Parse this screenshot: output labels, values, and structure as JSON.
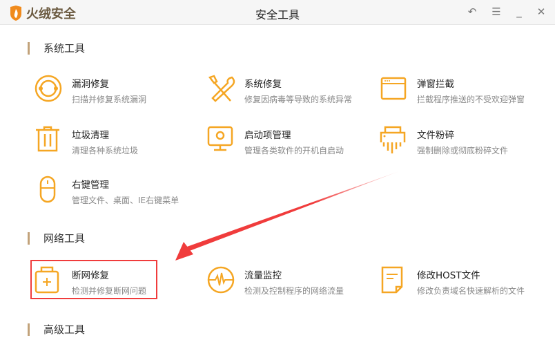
{
  "header": {
    "app_name": "火绒安全",
    "title": "安全工具"
  },
  "window_controls": [
    "back-icon",
    "menu-icon",
    "minimize-icon",
    "close-icon"
  ],
  "colors": {
    "accent": "#f5a623",
    "section_bar": "#c2a27a",
    "highlight": "#f03c3c"
  },
  "sections": [
    {
      "title": "系统工具",
      "items": [
        {
          "name": "漏洞修复",
          "desc": "扫描并修复系统漏洞",
          "icon": "vulnerability-icon"
        },
        {
          "name": "系统修复",
          "desc": "修复因病毒等导致的系统异常",
          "icon": "tools-icon"
        },
        {
          "name": "弹窗拦截",
          "desc": "拦截程序推送的不受欢迎弹窗",
          "icon": "popup-window-icon"
        },
        {
          "name": "垃圾清理",
          "desc": "清理各种系统垃圾",
          "icon": "trash-icon"
        },
        {
          "name": "启动项管理",
          "desc": "管理各类软件的开机自启动",
          "icon": "monitor-power-icon"
        },
        {
          "name": "文件粉碎",
          "desc": "强制删除或彻底粉碎文件",
          "icon": "shredder-icon"
        },
        {
          "name": "右键管理",
          "desc": "管理文件、桌面、IE右键菜单",
          "icon": "mouse-icon"
        }
      ]
    },
    {
      "title": "网络工具",
      "items": [
        {
          "name": "断网修复",
          "desc": "检测并修复断网问题",
          "icon": "first-aid-kit-icon"
        },
        {
          "name": "流量监控",
          "desc": "检测及控制程序的网络流量",
          "icon": "traffic-pulse-icon"
        },
        {
          "name": "修改HOST文件",
          "desc": "修改负责域名快速解析的文件",
          "icon": "document-icon"
        }
      ]
    },
    {
      "title": "高级工具",
      "items": []
    }
  ]
}
